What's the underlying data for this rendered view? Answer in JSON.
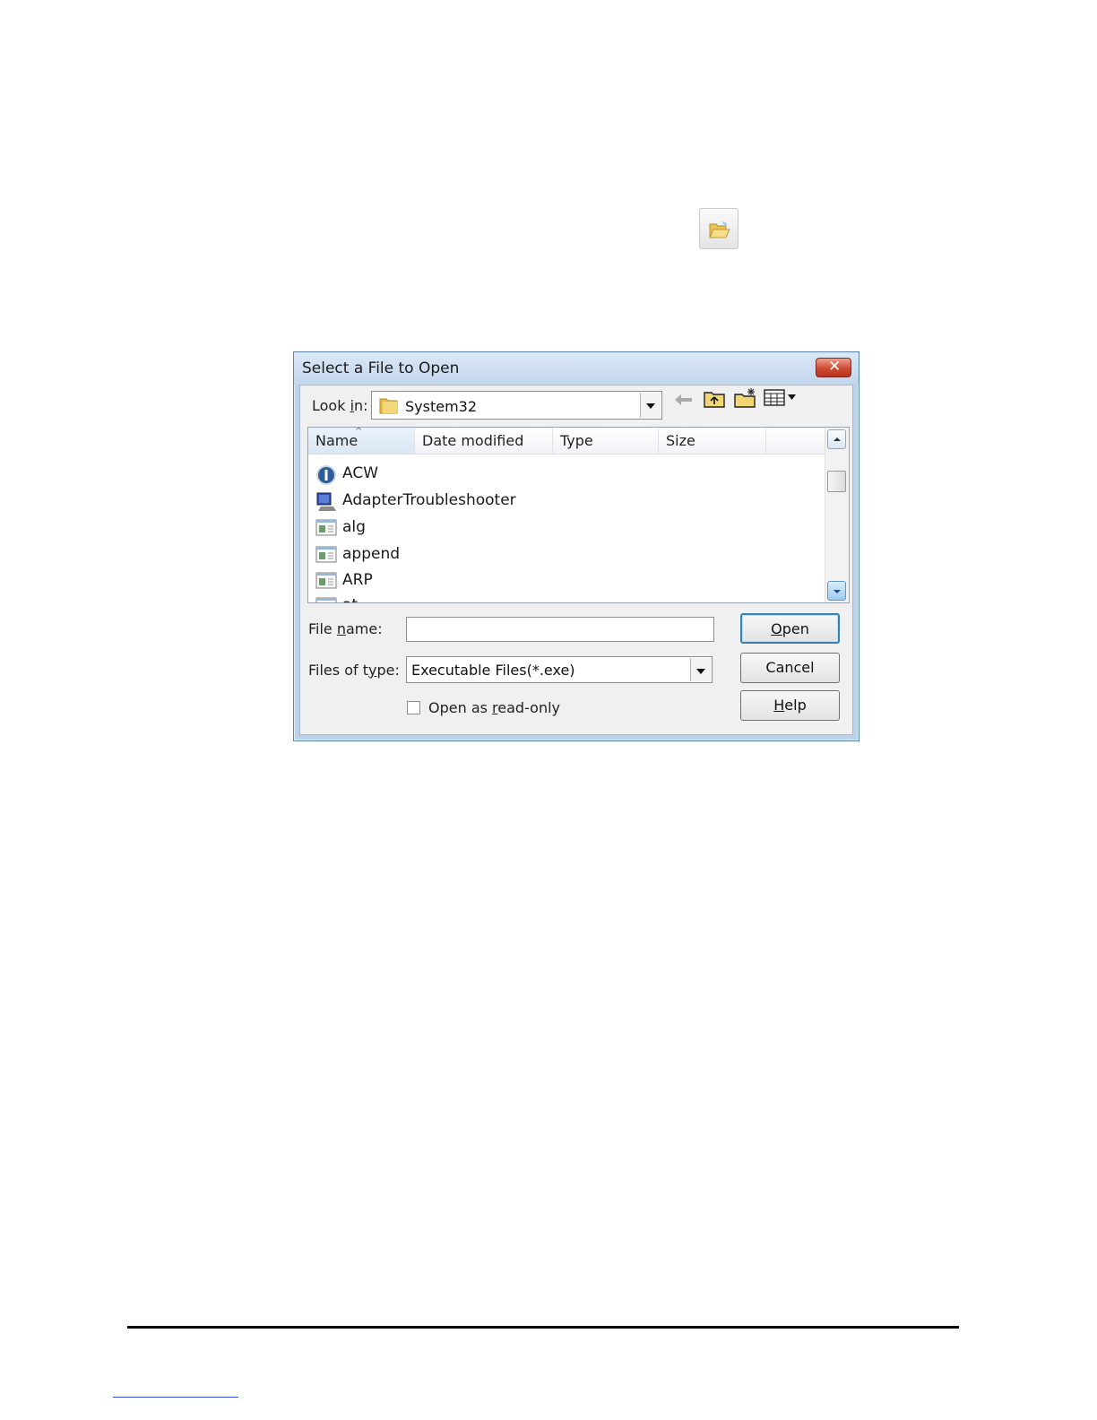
{
  "dialog": {
    "title": "Select a File to Open",
    "close_symbol": "✕",
    "look_in": {
      "label_prefix": "Look ",
      "label_key": "i",
      "label_suffix": "n:",
      "value": "System32"
    },
    "columns": [
      "Name",
      "Date modified",
      "Type",
      "Size"
    ],
    "files": [
      {
        "name": "ACW",
        "icon": "info-app-icon"
      },
      {
        "name": "AdapterTroubleshooter",
        "icon": "monitor-app-icon"
      },
      {
        "name": "alg",
        "icon": "exe-window-icon"
      },
      {
        "name": "append",
        "icon": "exe-window-icon"
      },
      {
        "name": "ARP",
        "icon": "exe-window-icon"
      },
      {
        "name": "at",
        "icon": "exe-window-icon"
      }
    ],
    "file_name": {
      "label_prefix": "File ",
      "label_key": "n",
      "label_suffix": "ame:",
      "value": ""
    },
    "files_of_type": {
      "label_prefix": "Files of t",
      "label_key": "y",
      "label_suffix": "pe:",
      "value": "Executable Files(*.exe)"
    },
    "read_only": {
      "label_prefix": "Open as ",
      "label_key": "r",
      "label_suffix": "ead-only",
      "checked": false
    },
    "buttons": {
      "open": {
        "key": "O",
        "rest": "pen"
      },
      "cancel": "Cancel",
      "help": {
        "key": "H",
        "rest": "elp"
      }
    }
  },
  "icons": [
    "open-folder-icon",
    "folder-icon",
    "back-arrow-icon",
    "up-folder-icon",
    "new-folder-icon",
    "view-menu-icon"
  ],
  "colors": {
    "title_bar": "#c3d6ec",
    "close_button": "#cc4a32",
    "default_button_border": "#3c7fb1"
  }
}
